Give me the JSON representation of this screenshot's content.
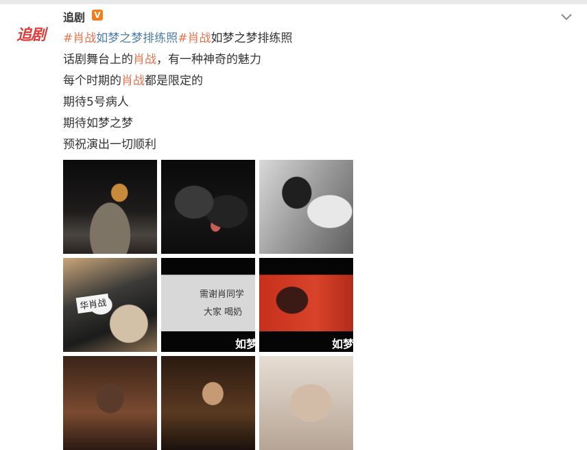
{
  "post": {
    "username": "追剧",
    "verified_badge": "V",
    "avatar_text": "追剧",
    "lines": [
      {
        "segments": [
          {
            "text": "#肖战",
            "cls": "tag"
          },
          {
            "text": "如梦之梦排练照",
            "cls": "link"
          },
          {
            "text": "#肖战",
            "cls": "tag"
          },
          {
            "text": "如梦之梦排练照",
            "cls": ""
          }
        ]
      },
      {
        "segments": [
          {
            "text": "话剧舞台上的",
            "cls": ""
          },
          {
            "text": "肖战",
            "cls": "hl"
          },
          {
            "text": "，有一种神奇的魅力",
            "cls": ""
          }
        ]
      },
      {
        "segments": [
          {
            "text": "每个时期的",
            "cls": ""
          },
          {
            "text": "肖战",
            "cls": "hl"
          },
          {
            "text": "都是限定的",
            "cls": ""
          }
        ]
      },
      {
        "segments": [
          {
            "text": "期待5号病人",
            "cls": ""
          }
        ]
      },
      {
        "segments": [
          {
            "text": "期待如梦之梦",
            "cls": ""
          }
        ]
      },
      {
        "segments": [
          {
            "text": "预祝演出一切顺利",
            "cls": ""
          }
        ]
      }
    ]
  },
  "photos": {
    "label_1": "华肖战",
    "script_1": "需谢肖同学",
    "script_2": "大家 喝奶",
    "logo_1": "如梦",
    "logo_2": "如梦"
  },
  "colors": {
    "tag": "#eb7350",
    "link": "#507daf",
    "text": "#333333"
  }
}
